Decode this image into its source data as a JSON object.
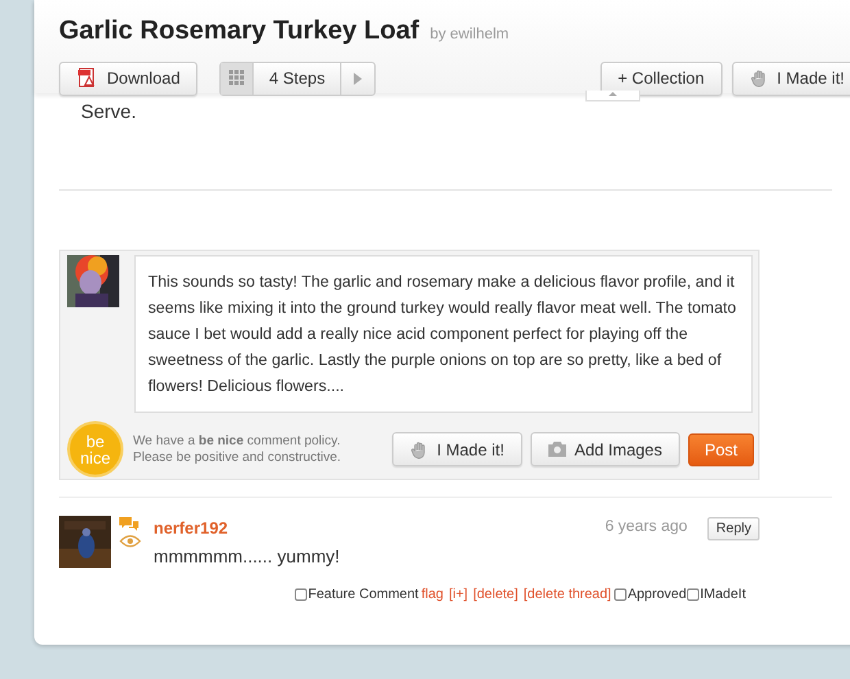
{
  "header": {
    "title": "Garlic Rosemary Turkey Loaf",
    "author": "by ewilhelm",
    "toolbar": {
      "download": "Download",
      "steps": "4 Steps",
      "collection": "+ Collection",
      "made_it": "I Made it!"
    }
  },
  "step_text": "Serve.",
  "comment_form": {
    "value": "This sounds so tasty!  The garlic and rosemary make a delicious flavor profile, and it seems like mixing it into the ground turkey would really flavor meat well.  The tomato sauce I bet would add a really nice acid component perfect for playing off the sweetness of the garlic.  Lastly the purple onions on top are so pretty, like a bed of flowers!  Delicious flowers....",
    "badge": "be nice",
    "policy": [
      "We have a **be nice** comment policy.",
      "Please be positive and constructive."
    ],
    "made_it": "I Made it!",
    "add_images": "Add Images",
    "post": "Post"
  },
  "comments": [
    {
      "user": "nerfer192",
      "time": "6 years ago",
      "reply": "Reply",
      "text": "mmmmmm...... yummy!",
      "actions": [
        {
          "kind": "checkbox",
          "label": "Feature Comment",
          "checked": false
        },
        {
          "kind": "link",
          "label": "flag"
        },
        {
          "kind": "link",
          "label": "[i+]"
        },
        {
          "kind": "link",
          "label": "[delete]"
        },
        {
          "kind": "link",
          "label": "[delete thread]"
        },
        {
          "kind": "checkbox",
          "label": "Approved",
          "checked": false
        },
        {
          "kind": "checkbox",
          "label": "IMadeIt",
          "checked": false
        }
      ]
    }
  ]
}
